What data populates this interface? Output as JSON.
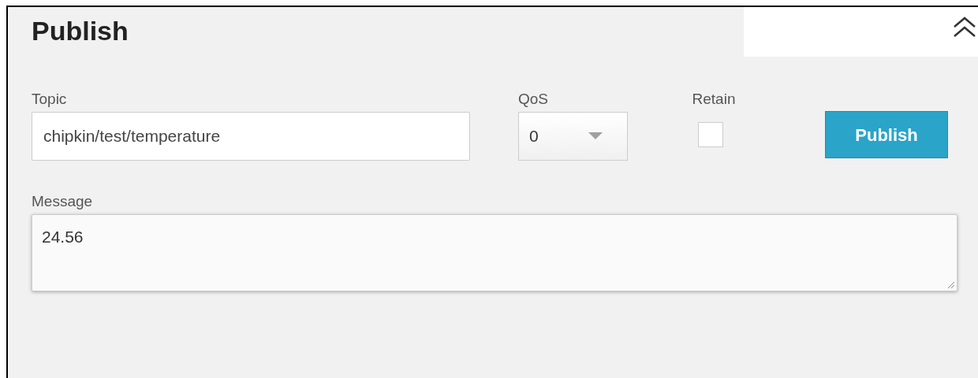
{
  "panel": {
    "title": "Publish"
  },
  "topic": {
    "label": "Topic",
    "value": "chipkin/test/temperature"
  },
  "qos": {
    "label": "QoS",
    "value": "0"
  },
  "retain": {
    "label": "Retain",
    "checked": false
  },
  "publish_button": {
    "label": "Publish"
  },
  "message": {
    "label": "Message",
    "value": "24.56"
  }
}
